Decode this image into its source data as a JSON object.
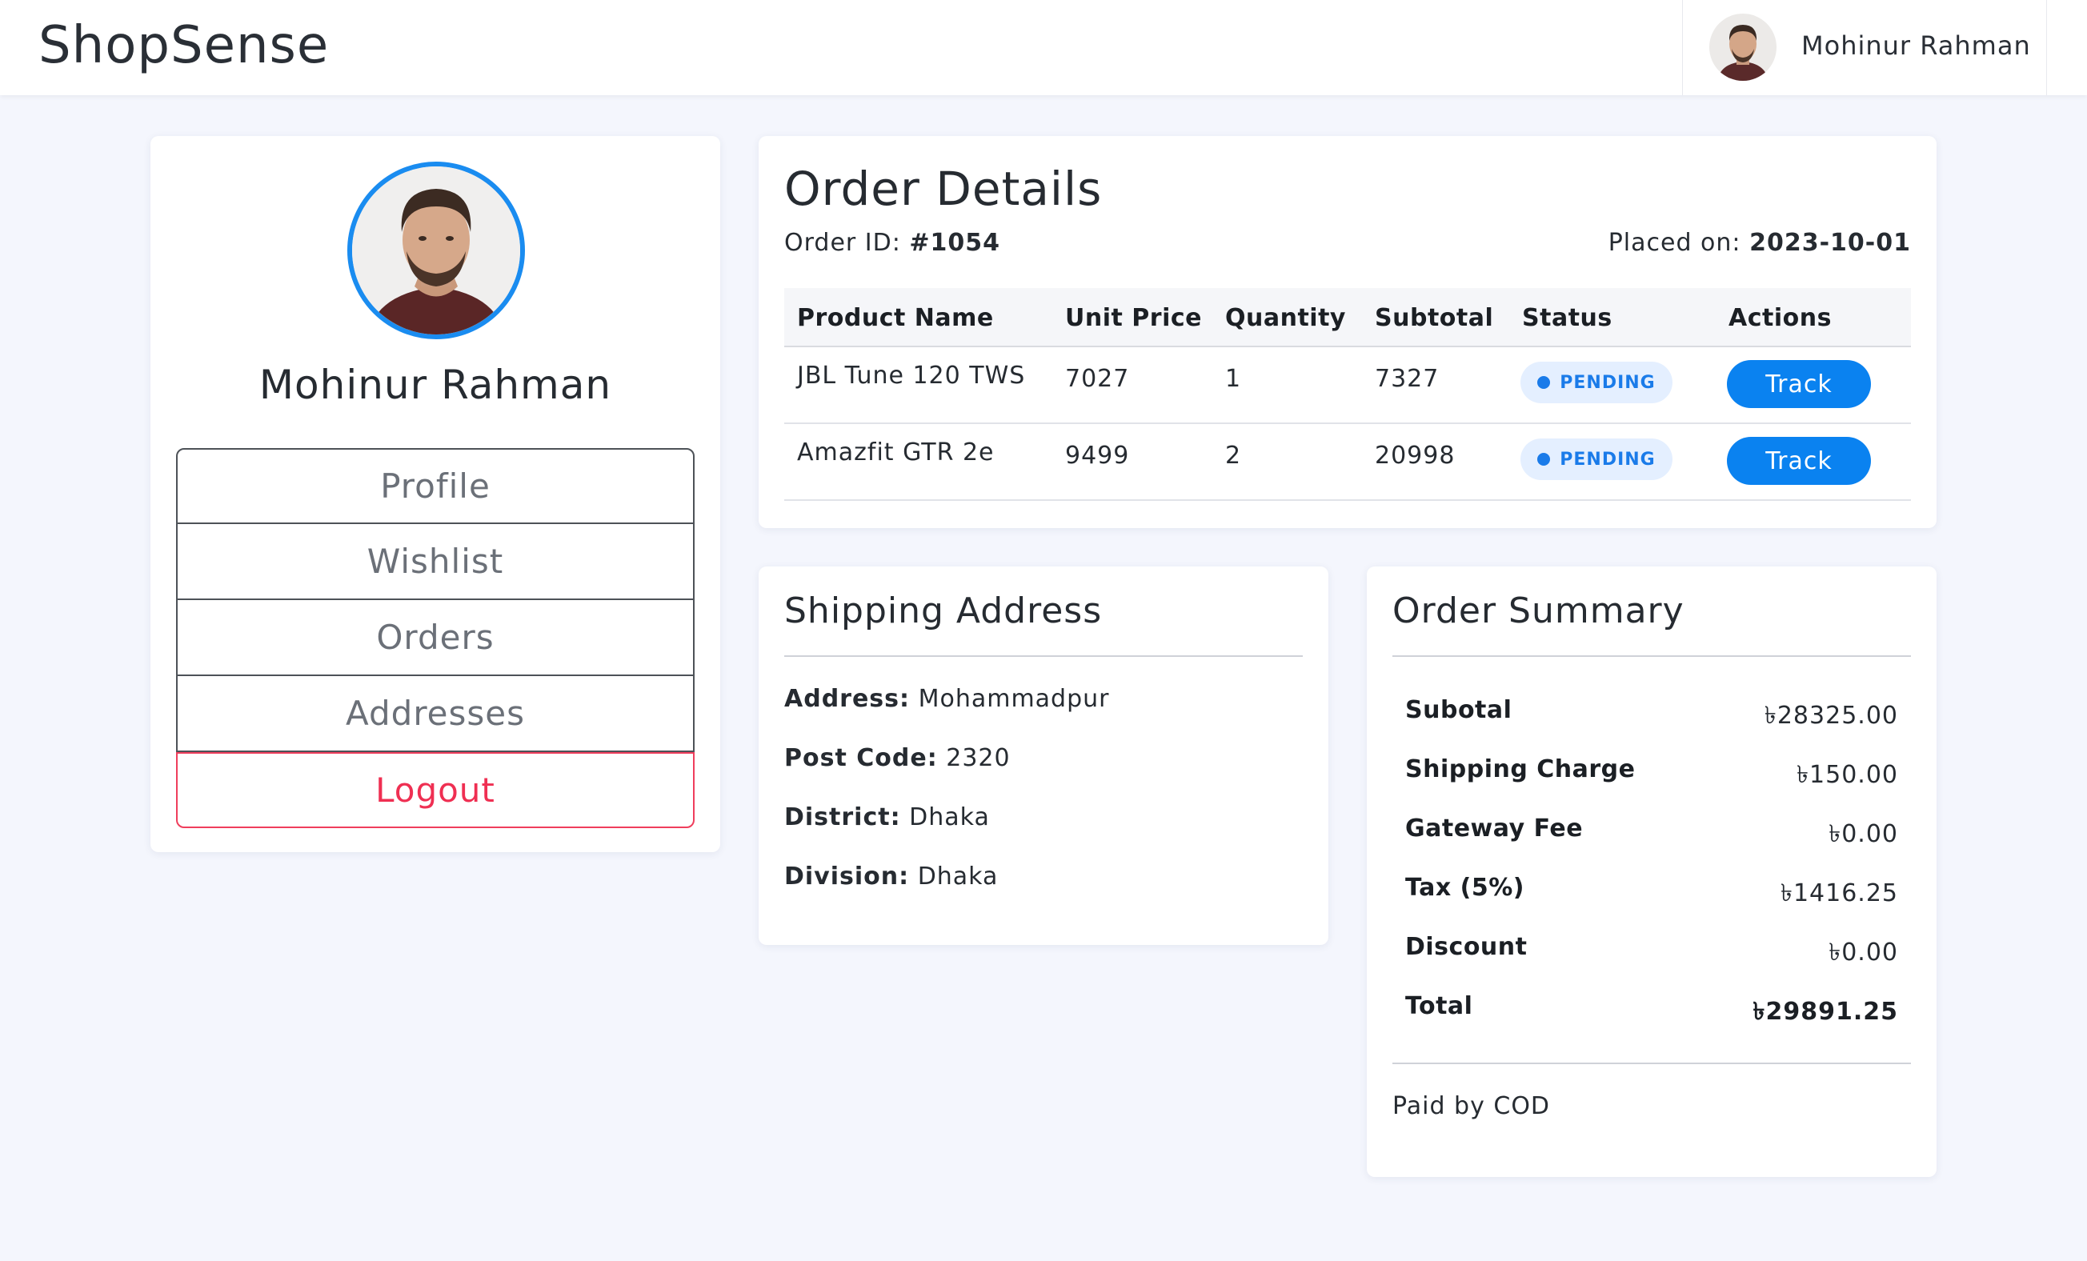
{
  "header": {
    "brand": "ShopSense",
    "user_name": "Mohinur Rahman"
  },
  "sidebar": {
    "name": "Mohinur Rahman",
    "menu": [
      "Profile",
      "Wishlist",
      "Orders",
      "Addresses"
    ],
    "logout": "Logout"
  },
  "order": {
    "title": "Order Details",
    "id_label": "Order ID:",
    "id_value": "#1054",
    "placed_label": "Placed on:",
    "placed_value": "2023-10-01",
    "columns": [
      "Product Name",
      "Unit Price",
      "Quantity",
      "Subtotal",
      "Status",
      "Actions"
    ],
    "rows": [
      {
        "product": "JBL Tune 120 TWS",
        "unit_price": "7027",
        "quantity": "1",
        "subtotal": "7327",
        "status": "PENDING",
        "action": "Track"
      },
      {
        "product": "Amazfit GTR 2e",
        "unit_price": "9499",
        "quantity": "2",
        "subtotal": "20998",
        "status": "PENDING",
        "action": "Track"
      }
    ]
  },
  "shipping": {
    "title": "Shipping Address",
    "address_label": "Address:",
    "address_value": "Mohammadpur",
    "postcode_label": "Post Code:",
    "postcode_value": "2320",
    "district_label": "District:",
    "district_value": "Dhaka",
    "division_label": "Division:",
    "division_value": "Dhaka"
  },
  "summary": {
    "title": "Order Summary",
    "rows": [
      {
        "label": "Subotal",
        "value": "৳28325.00"
      },
      {
        "label": "Shipping Charge",
        "value": "৳150.00"
      },
      {
        "label": "Gateway Fee",
        "value": "৳0.00"
      },
      {
        "label": "Tax (5%)",
        "value": "৳1416.25"
      },
      {
        "label": "Discount",
        "value": "৳0.00"
      },
      {
        "label": "Total",
        "value": "৳29891.25"
      }
    ],
    "paid_by": "Paid by COD"
  },
  "colors": {
    "accent": "#0a82f0",
    "logout": "#ef2f52",
    "badge_bg": "#e4efff",
    "page_bg": "#f4f6fd"
  }
}
